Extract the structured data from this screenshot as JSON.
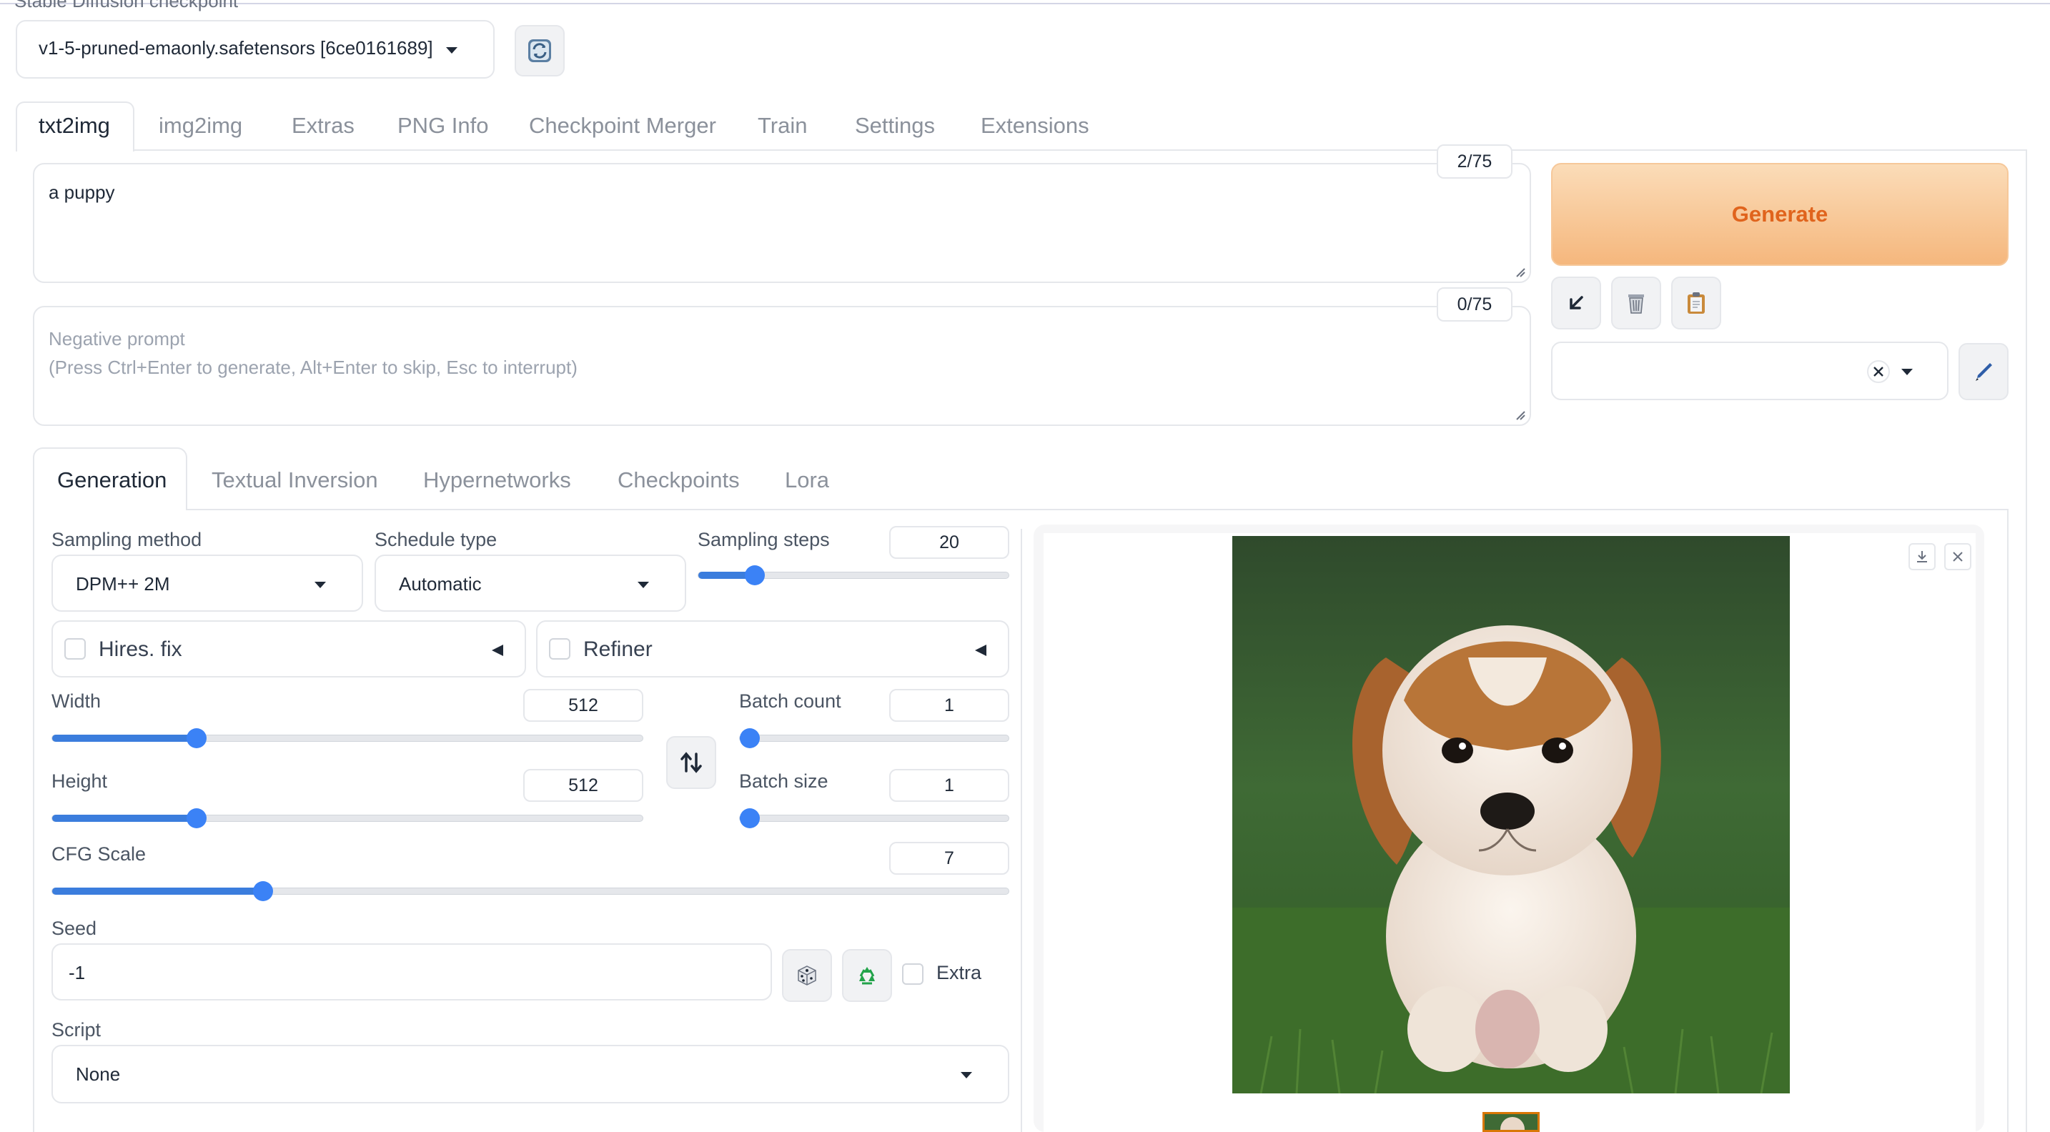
{
  "checkpoint": {
    "label": "Stable Diffusion checkpoint",
    "value": "v1-5-pruned-emaonly.safetensors [6ce0161689]",
    "refresh_icon": "refresh-icon"
  },
  "main_tabs": [
    "txt2img",
    "img2img",
    "Extras",
    "PNG Info",
    "Checkpoint Merger",
    "Train",
    "Settings",
    "Extensions"
  ],
  "prompt": {
    "value": "a puppy",
    "token_count": "2/75"
  },
  "negative_prompt": {
    "placeholder": "Negative prompt\n(Press Ctrl+Enter to generate, Alt+Enter to skip, Esc to interrupt)",
    "line1": "Negative prompt",
    "line2": "(Press Ctrl+Enter to generate, Alt+Enter to skip, Esc to interrupt)",
    "token_count": "0/75"
  },
  "generate": {
    "label": "Generate",
    "tool_icons": [
      "arrow-down-left-icon",
      "trash-icon",
      "clipboard-icon"
    ],
    "styles_clear_icon": "close-icon",
    "edit_icon": "pencil-icon"
  },
  "sub_tabs": [
    "Generation",
    "Textual Inversion",
    "Hypernetworks",
    "Checkpoints",
    "Lora"
  ],
  "generation": {
    "sampling_method": {
      "label": "Sampling method",
      "value": "DPM++ 2M"
    },
    "schedule_type": {
      "label": "Schedule type",
      "value": "Automatic"
    },
    "sampling_steps": {
      "label": "Sampling steps",
      "value": "20",
      "fraction": 0.16
    },
    "hires_fix": {
      "label": "Hires. fix"
    },
    "refiner": {
      "label": "Refiner"
    },
    "width": {
      "label": "Width",
      "value": "512",
      "fraction": 0.235
    },
    "height": {
      "label": "Height",
      "value": "512",
      "fraction": 0.235
    },
    "batch_count": {
      "label": "Batch count",
      "value": "1",
      "fraction": 0.0
    },
    "batch_size": {
      "label": "Batch size",
      "value": "1",
      "fraction": 0.0
    },
    "cfg_scale": {
      "label": "CFG Scale",
      "value": "7",
      "fraction": 0.214
    },
    "seed": {
      "label": "Seed",
      "value": "-1",
      "extra_label": "Extra"
    },
    "script": {
      "label": "Script",
      "value": "None"
    }
  },
  "output": {
    "image_alt": "puppy",
    "download_icon": "download-icon",
    "close_icon": "close-icon"
  },
  "colors": {
    "accent": "#3b82f6",
    "generate_bg": "#f8c594",
    "generate_text": "#e0641d"
  }
}
